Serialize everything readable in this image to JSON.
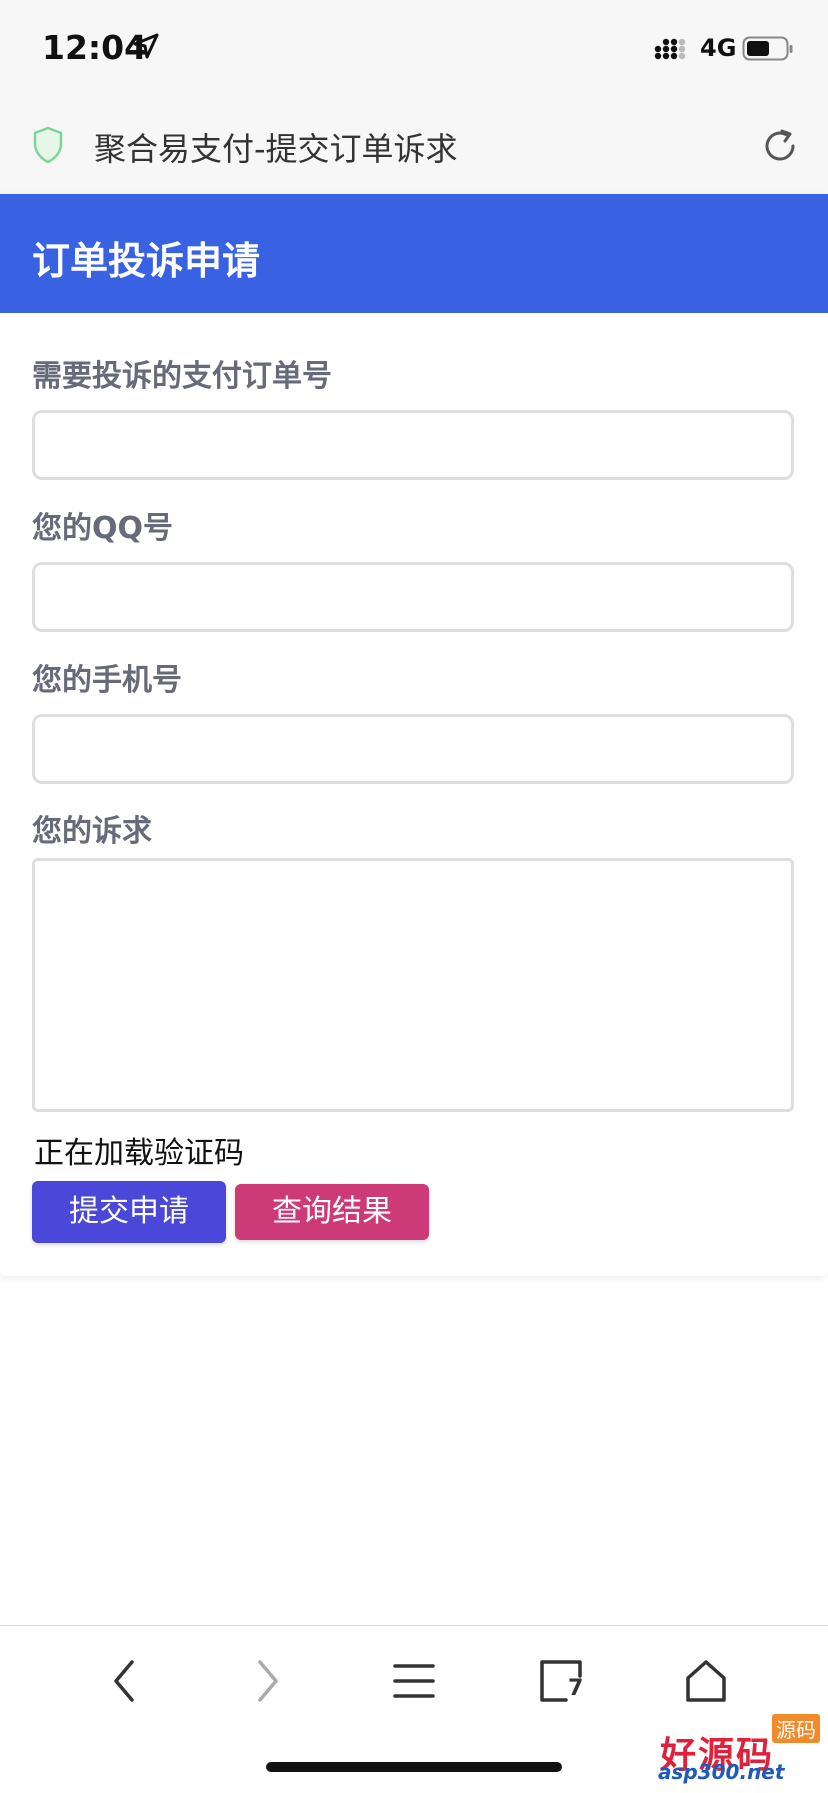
{
  "status_bar": {
    "time": "12:04",
    "network": "4G"
  },
  "browser": {
    "page_title": "聚合易支付-提交订单诉求"
  },
  "form": {
    "header_title": "订单投诉申请",
    "fields": [
      {
        "label": "需要投诉的支付订单号",
        "value": ""
      },
      {
        "label": "您的QQ号",
        "value": ""
      },
      {
        "label": "您的手机号",
        "value": ""
      },
      {
        "label": "您的诉求",
        "value": ""
      }
    ],
    "captcha_status": "正在加载验证码",
    "submit_label": "提交申请",
    "query_label": "查询结果"
  },
  "colors": {
    "header_bg": "#3962e3",
    "submit_bg": "#4b47d8",
    "query_bg": "#cd3a78"
  },
  "toolbar": {
    "tabs_count": "7"
  },
  "watermark": {
    "main": "好源码",
    "sub": "asp300.net",
    "tag": "源码"
  }
}
